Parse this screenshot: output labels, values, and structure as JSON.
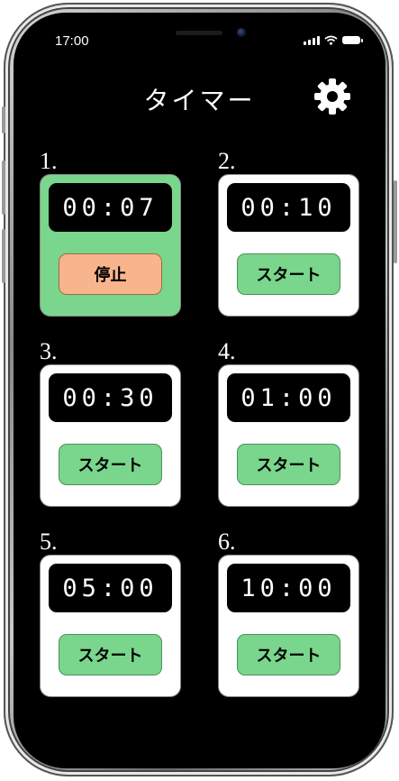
{
  "status_bar": {
    "time": "17:00"
  },
  "header": {
    "title": "タイマー",
    "settings_icon": "gear-icon"
  },
  "colors": {
    "running_card": "#79d68c",
    "start_button": "#79d68c",
    "stop_button": "#f7b48d"
  },
  "timers": [
    {
      "label": "1.",
      "time": "00:07",
      "button": "停止",
      "state": "running"
    },
    {
      "label": "2.",
      "time": "00:10",
      "button": "スタート",
      "state": "idle"
    },
    {
      "label": "3.",
      "time": "00:30",
      "button": "スタート",
      "state": "idle"
    },
    {
      "label": "4.",
      "time": "01:00",
      "button": "スタート",
      "state": "idle"
    },
    {
      "label": "5.",
      "time": "05:00",
      "button": "スタート",
      "state": "idle"
    },
    {
      "label": "6.",
      "time": "10:00",
      "button": "スタート",
      "state": "idle"
    }
  ]
}
